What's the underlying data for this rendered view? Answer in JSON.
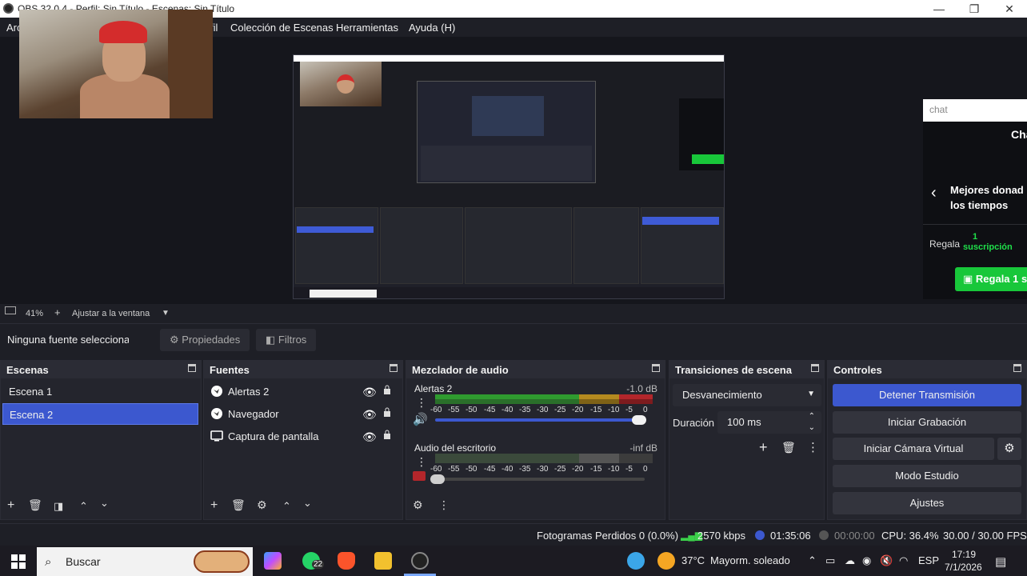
{
  "window": {
    "title": "OBS 32.0.4 - Perfil: Sin Título - Escenas: Sin Título",
    "min": "—",
    "max": "❐",
    "close": "✕"
  },
  "menu": {
    "first": "Arc",
    "profile_tail": "fil",
    "items": [
      "Colección de Escenas",
      "Herramientas",
      "Ayuda (H)"
    ]
  },
  "chat": {
    "placeholder": "chat",
    "title": "Cha",
    "desc_line1": "Mejores donad",
    "desc_line2": "los tiempos",
    "gift": "Regala",
    "sub_count": "1",
    "sub_label": "suscripción",
    "button": "Regala 1 s"
  },
  "zoom": {
    "value": "41%",
    "fit": "Ajustar a la ventana"
  },
  "sourcebar": {
    "none": "Ninguna fuente seleccionada",
    "props": "Propiedades",
    "filters": "Filtros"
  },
  "scenes": {
    "title": "Escenas",
    "items": [
      "Escena 1",
      "Escena 2"
    ],
    "selected": 1
  },
  "sources": {
    "title": "Fuentes",
    "items": [
      {
        "name": "Alertas 2",
        "icon": "browser-icon"
      },
      {
        "name": "Navegador",
        "icon": "browser-icon"
      },
      {
        "name": "Captura de pantalla",
        "icon": "monitor-icon"
      }
    ]
  },
  "mixer": {
    "title": "Mezclador de audio",
    "ticks": [
      "-60",
      "-55",
      "-50",
      "-45",
      "-40",
      "-35",
      "-30",
      "-25",
      "-20",
      "-15",
      "-10",
      "-5",
      "0"
    ],
    "channels": [
      {
        "name": "Alertas 2",
        "db": "-1.0 dB",
        "muted": false
      },
      {
        "name": "Audio del escritorio",
        "db": "-inf dB",
        "muted": true
      }
    ]
  },
  "transitions": {
    "title": "Transiciones de escena",
    "type": "Desvanecimiento",
    "duration_label": "Duración",
    "duration": "100 ms"
  },
  "controls": {
    "title": "Controles",
    "buttons": [
      "Detener Transmisión",
      "Iniciar Grabación",
      "Iniciar Cámara Virtual",
      "Modo Estudio",
      "Ajustes"
    ]
  },
  "status": {
    "dropped": "Fotogramas Perdidos 0 (0.0%)",
    "bitrate": "2570 kbps",
    "live_time": "01:35:06",
    "rec_time": "00:00:00",
    "cpu": "CPU: 36.4%",
    "fps": "30.00 / 30.00 FPS"
  },
  "taskbar": {
    "search": "Buscar",
    "whatsapp_badge": "22",
    "weather": "37°C",
    "weather_text": "Mayorm. soleado",
    "lang": "ESP",
    "time": "17:19",
    "date": "7/1/2026"
  },
  "colors": {
    "accent": "#3c58cf",
    "meter_green": "#2f9b2f",
    "meter_yellow": "#b58a1f",
    "meter_red": "#b3262b",
    "twitch_green": "#18c73a"
  }
}
